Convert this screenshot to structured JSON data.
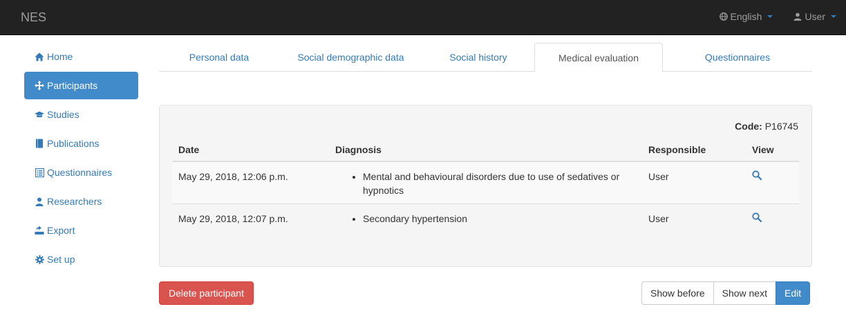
{
  "navbar": {
    "brand": "NES",
    "language_label": "English",
    "user_label": "User"
  },
  "sidebar": {
    "items": [
      {
        "label": "Home",
        "icon": "home-icon"
      },
      {
        "label": "Participants",
        "icon": "move-icon",
        "active": true
      },
      {
        "label": "Studies",
        "icon": "education-icon"
      },
      {
        "label": "Publications",
        "icon": "book-icon"
      },
      {
        "label": "Questionnaires",
        "icon": "list-alt-icon"
      },
      {
        "label": "Researchers",
        "icon": "user-icon"
      },
      {
        "label": "Export",
        "icon": "export-icon"
      },
      {
        "label": "Set up",
        "icon": "cog-icon"
      }
    ]
  },
  "tabs": [
    {
      "label": "Personal data"
    },
    {
      "label": "Social demographic data"
    },
    {
      "label": "Social history"
    },
    {
      "label": "Medical evaluation",
      "active": true
    },
    {
      "label": "Questionnaires"
    }
  ],
  "panel": {
    "code_label": "Code:",
    "code_value": "P16745",
    "columns": [
      "Date",
      "Diagnosis",
      "Responsible",
      "View"
    ],
    "rows": [
      {
        "date": "May 29, 2018, 12:06 p.m.",
        "diagnosis": "Mental and behavioural disorders due to use of sedatives or hypnotics",
        "responsible": "User"
      },
      {
        "date": "May 29, 2018, 12:07 p.m.",
        "diagnosis": "Secondary hypertension",
        "responsible": "User"
      }
    ]
  },
  "actions": {
    "delete_label": "Delete participant",
    "show_before_label": "Show before",
    "show_next_label": "Show next",
    "edit_label": "Edit"
  },
  "colors": {
    "navbar_bg": "#222222",
    "link": "#337ab7",
    "active_bg": "#428bca",
    "danger": "#d9534f"
  }
}
